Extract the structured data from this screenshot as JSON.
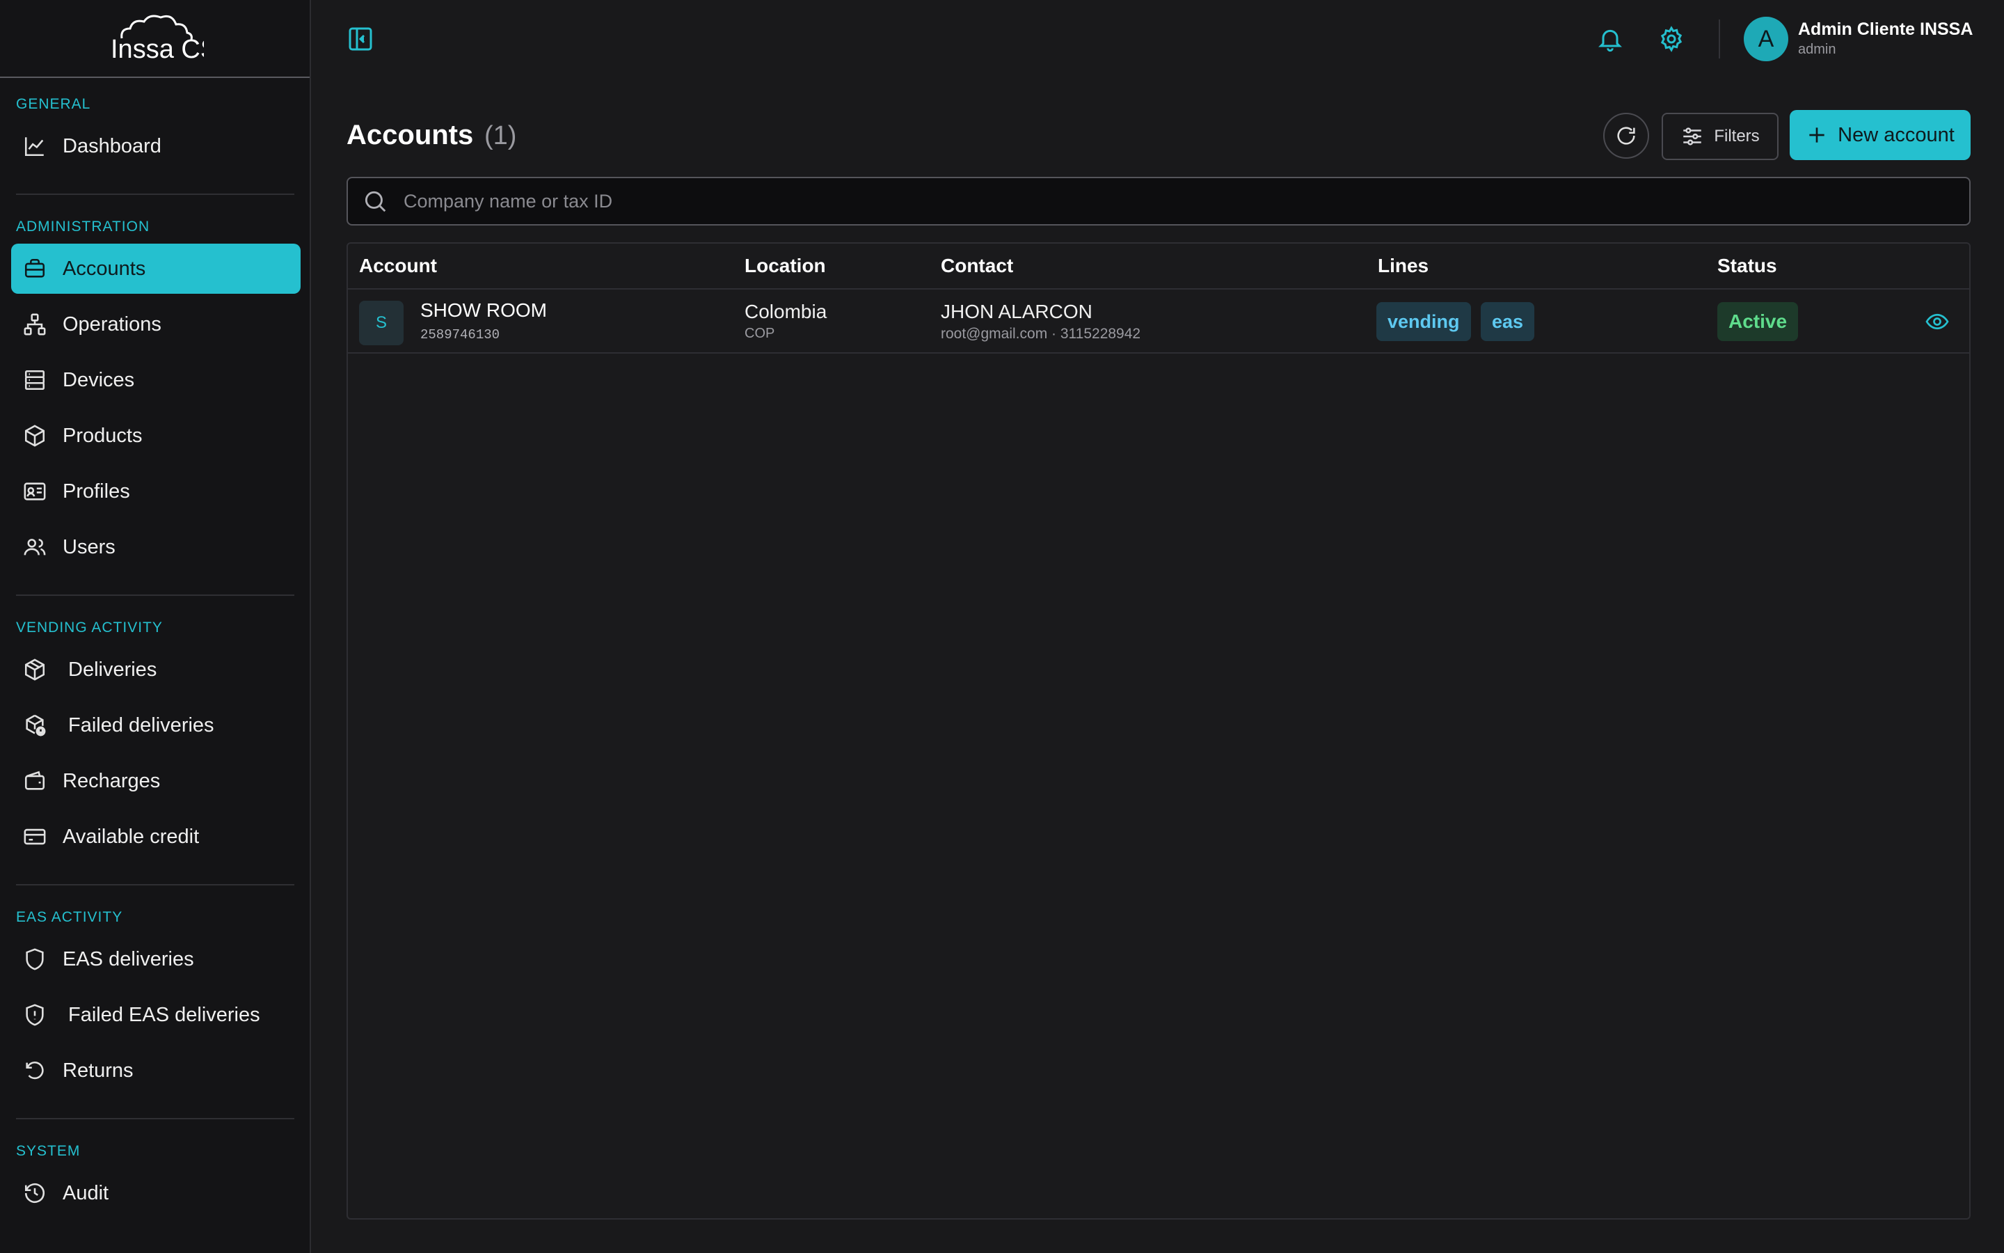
{
  "brand": {
    "logo_text": "Inssa CS"
  },
  "sidebar": {
    "sections": [
      {
        "title": "General",
        "items": [
          {
            "label": "Dashboard",
            "icon": "chart-line-icon"
          }
        ]
      },
      {
        "title": "Administration",
        "items": [
          {
            "label": "Accounts",
            "icon": "briefcase-icon",
            "active": true
          },
          {
            "label": "Operations",
            "icon": "network-icon"
          },
          {
            "label": "Devices",
            "icon": "server-icon"
          },
          {
            "label": "Products",
            "icon": "box-icon"
          },
          {
            "label": "Profiles",
            "icon": "id-card-icon"
          },
          {
            "label": "Users",
            "icon": "users-icon"
          }
        ]
      },
      {
        "title": "Vending activity",
        "items": [
          {
            "label": "Deliveries",
            "icon": "package-icon"
          },
          {
            "label": "Failed deliveries",
            "icon": "package-alert-icon"
          },
          {
            "label": "Recharges",
            "icon": "wallet-icon"
          },
          {
            "label": "Available credit",
            "icon": "credit-card-icon"
          }
        ]
      },
      {
        "title": "EAS activity",
        "items": [
          {
            "label": "EAS deliveries",
            "icon": "shield-icon"
          },
          {
            "label": "Failed EAS deliveries",
            "icon": "shield-alert-icon"
          },
          {
            "label": "Returns",
            "icon": "undo-icon"
          }
        ]
      },
      {
        "title": "System",
        "items": [
          {
            "label": "Audit",
            "icon": "history-icon"
          }
        ]
      }
    ]
  },
  "topbar": {
    "user": {
      "initial": "A",
      "name": "Admin Cliente INSSA",
      "role": "admin"
    }
  },
  "page": {
    "title": "Accounts",
    "count": "(1)",
    "filters_label": "Filters",
    "new_label": "New account",
    "search_placeholder": "Company name or tax ID"
  },
  "table": {
    "columns": [
      "Account",
      "Location",
      "Contact",
      "Lines",
      "Status"
    ],
    "rows": [
      {
        "initial": "S",
        "name": "SHOW ROOM",
        "tax_id": "2589746130",
        "country": "Colombia",
        "currency": "COP",
        "contact_name": "JHON ALARCON",
        "contact_detail": "root@gmail.com · 3115228942",
        "lines": [
          "vending",
          "eas"
        ],
        "status": "Active"
      }
    ]
  },
  "colors": {
    "accent": "#25c0cf",
    "background": "#19191b",
    "sidebar": "#141416",
    "status_active": "#5fdc8c"
  }
}
